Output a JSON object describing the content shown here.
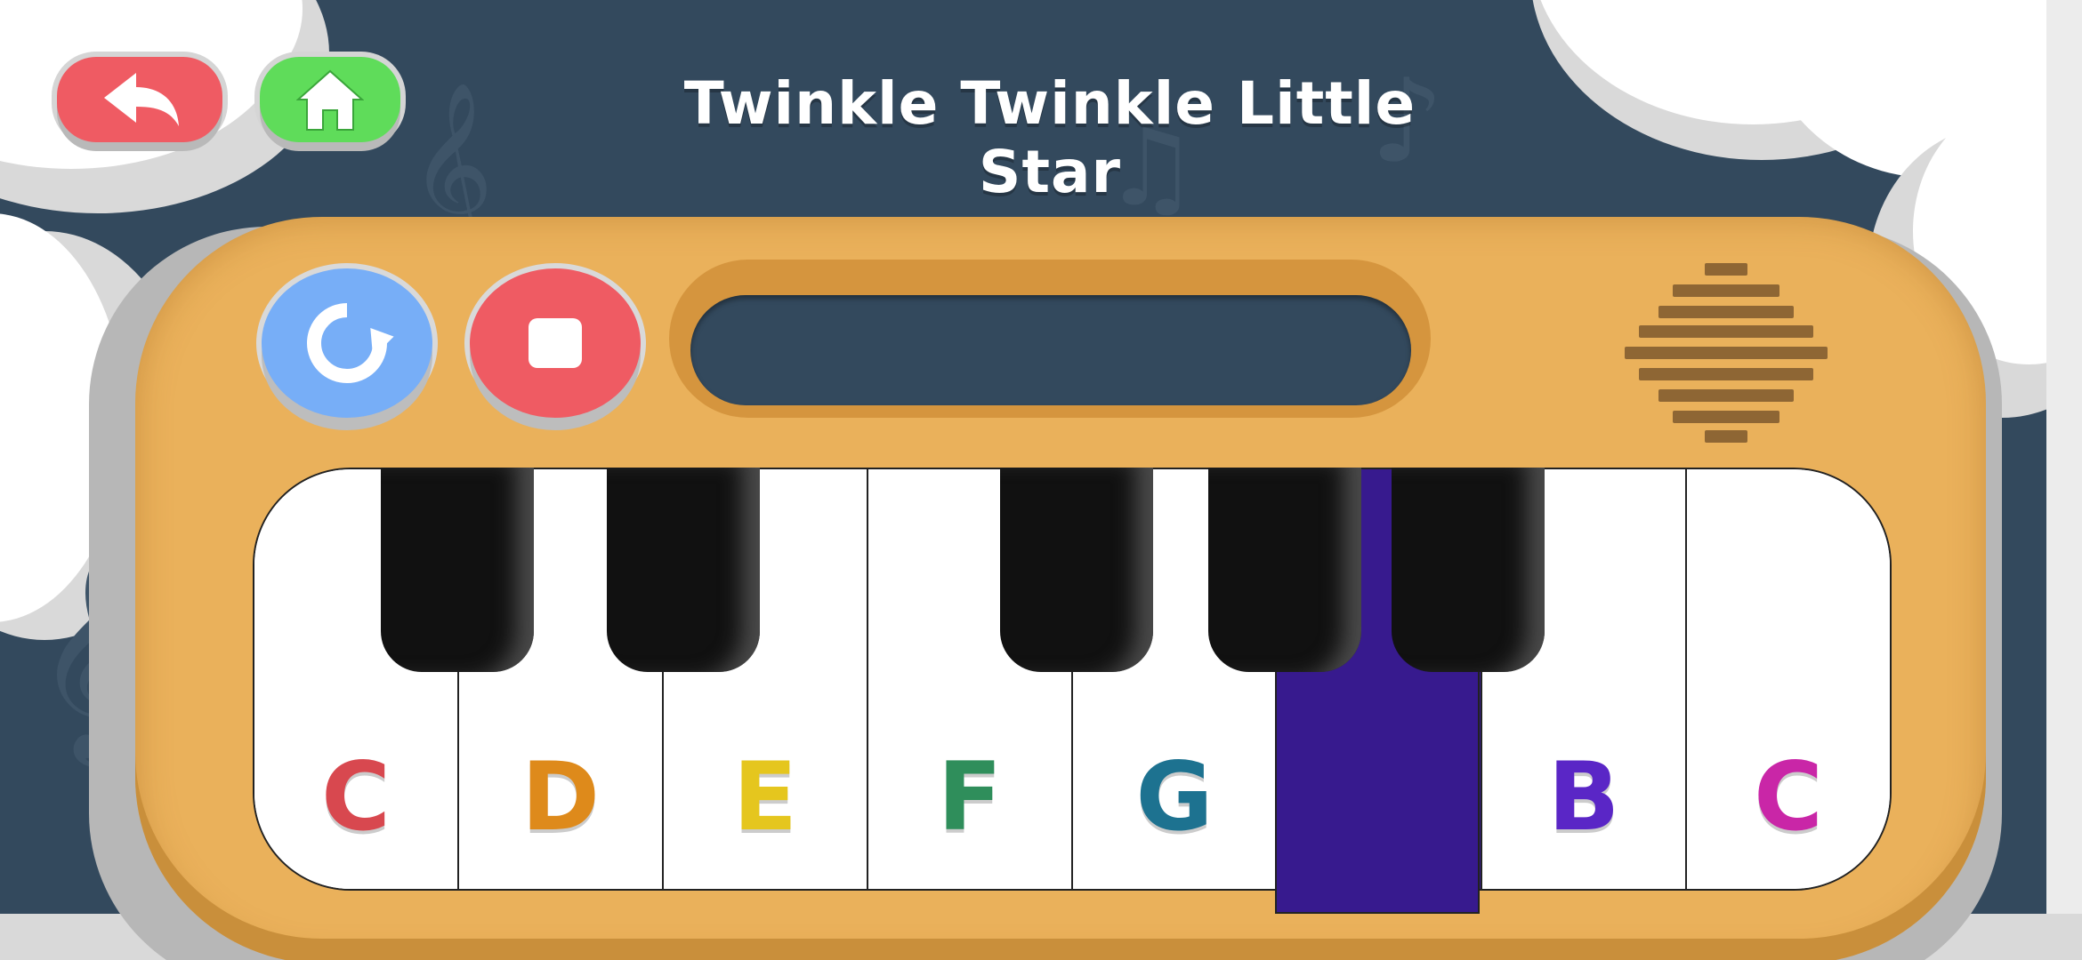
{
  "title": "Twinkle Twinkle Little Star",
  "buttons": {
    "back": {
      "icon": "back-arrow-icon",
      "color": "#ef5b63"
    },
    "home": {
      "icon": "home-icon",
      "color": "#5fdc5a"
    },
    "replay": {
      "icon": "replay-icon",
      "color": "#77aef7"
    },
    "stop": {
      "icon": "stop-icon",
      "color": "#ef5b63"
    }
  },
  "piano": {
    "body_color": "#eab15b",
    "pressed_key_color": "#371a8e",
    "white_keys": [
      {
        "label": "C",
        "color": "#d8484f",
        "pressed": false
      },
      {
        "label": "D",
        "color": "#de8a1b",
        "pressed": false
      },
      {
        "label": "E",
        "color": "#e5c61e",
        "pressed": false
      },
      {
        "label": "F",
        "color": "#2f8e5b",
        "pressed": false
      },
      {
        "label": "G",
        "color": "#1d7290",
        "pressed": false
      },
      {
        "label": "",
        "color": "#371a8e",
        "pressed": true
      },
      {
        "label": "B",
        "color": "#5a26c6",
        "pressed": false
      },
      {
        "label": "C",
        "color": "#c926a7",
        "pressed": false
      }
    ],
    "black_keys": 5
  }
}
